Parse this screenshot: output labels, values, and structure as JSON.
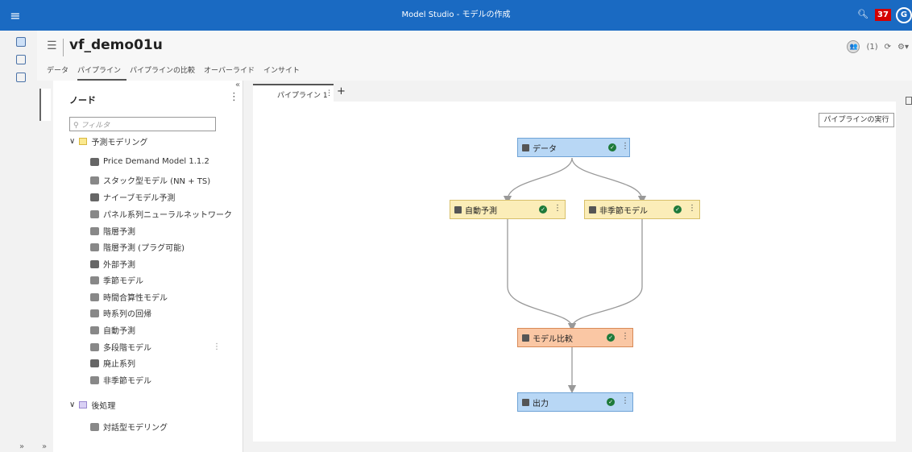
{
  "app": {
    "title": "Model Studio - モデルの作成",
    "notification_count": "37",
    "avatar_letter": "G"
  },
  "header": {
    "project_title": "vf_demo01u",
    "tabs": [
      "データ",
      "パイプライン",
      "パイプラインの比較",
      "オーバーライド",
      "インサイト"
    ],
    "active_tab": "パイプライン",
    "users_count": "(1)"
  },
  "nodes_panel": {
    "title": "ノード",
    "filter_placeholder": "フィルタ",
    "groups": [
      {
        "label": "予測モデリング",
        "items": [
          "Price Demand Model 1.1.2",
          "スタック型モデル (NN + TS)",
          "ナイーブモデル予測",
          "パネル系列ニューラルネットワーク",
          "階層予測",
          "階層予測 (プラグ可能)",
          "外部予測",
          "季節モデル",
          "時間合算性モデル",
          "時系列の回帰",
          "自動予測",
          "多段階モデル",
          "廃止系列",
          "非季節モデル"
        ]
      },
      {
        "label": "後処理",
        "items": [
          "対話型モデリング"
        ]
      }
    ]
  },
  "pipeline": {
    "tab_label": "パイプライン 1",
    "run_button": "パイプラインの実行",
    "nodes": {
      "data": "データ",
      "auto": "自動予測",
      "nonseasonal": "非季節モデル",
      "compare": "モデル比較",
      "output": "出力"
    }
  },
  "colors": {
    "topbar": "#1a6ac2",
    "node_blue": "#b8d7f5",
    "node_yellow": "#fbedb8",
    "node_orange": "#fac7a4",
    "success": "#1e7a3a"
  }
}
